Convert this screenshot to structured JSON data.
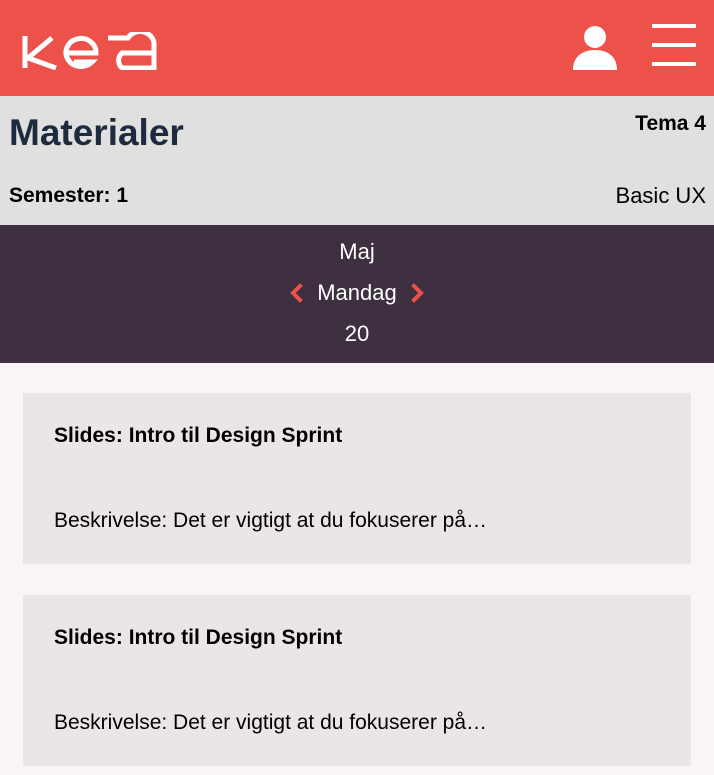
{
  "header": {
    "logo_text": "KEA",
    "brand_color": "#ec514a",
    "user_icon": "user-icon",
    "menu_icon": "hamburger-menu-icon"
  },
  "page": {
    "title": "Materialer",
    "tema": "Tema 4",
    "semester": "Semester: 1",
    "course": "Basic UX"
  },
  "date_nav": {
    "month": "Maj",
    "weekday": "Mandag",
    "day": "20",
    "prev_icon": "chevron-left-icon",
    "next_icon": "chevron-right-icon",
    "background": "#3e3040"
  },
  "materials": [
    {
      "title": "Slides: Intro til Design Sprint",
      "description": "Beskrivelse: Det er vigtigt at du fokuserer på…"
    },
    {
      "title": "Slides: Intro til Design Sprint",
      "description": "Beskrivelse: Det er vigtigt at du fokuserer på…"
    }
  ]
}
